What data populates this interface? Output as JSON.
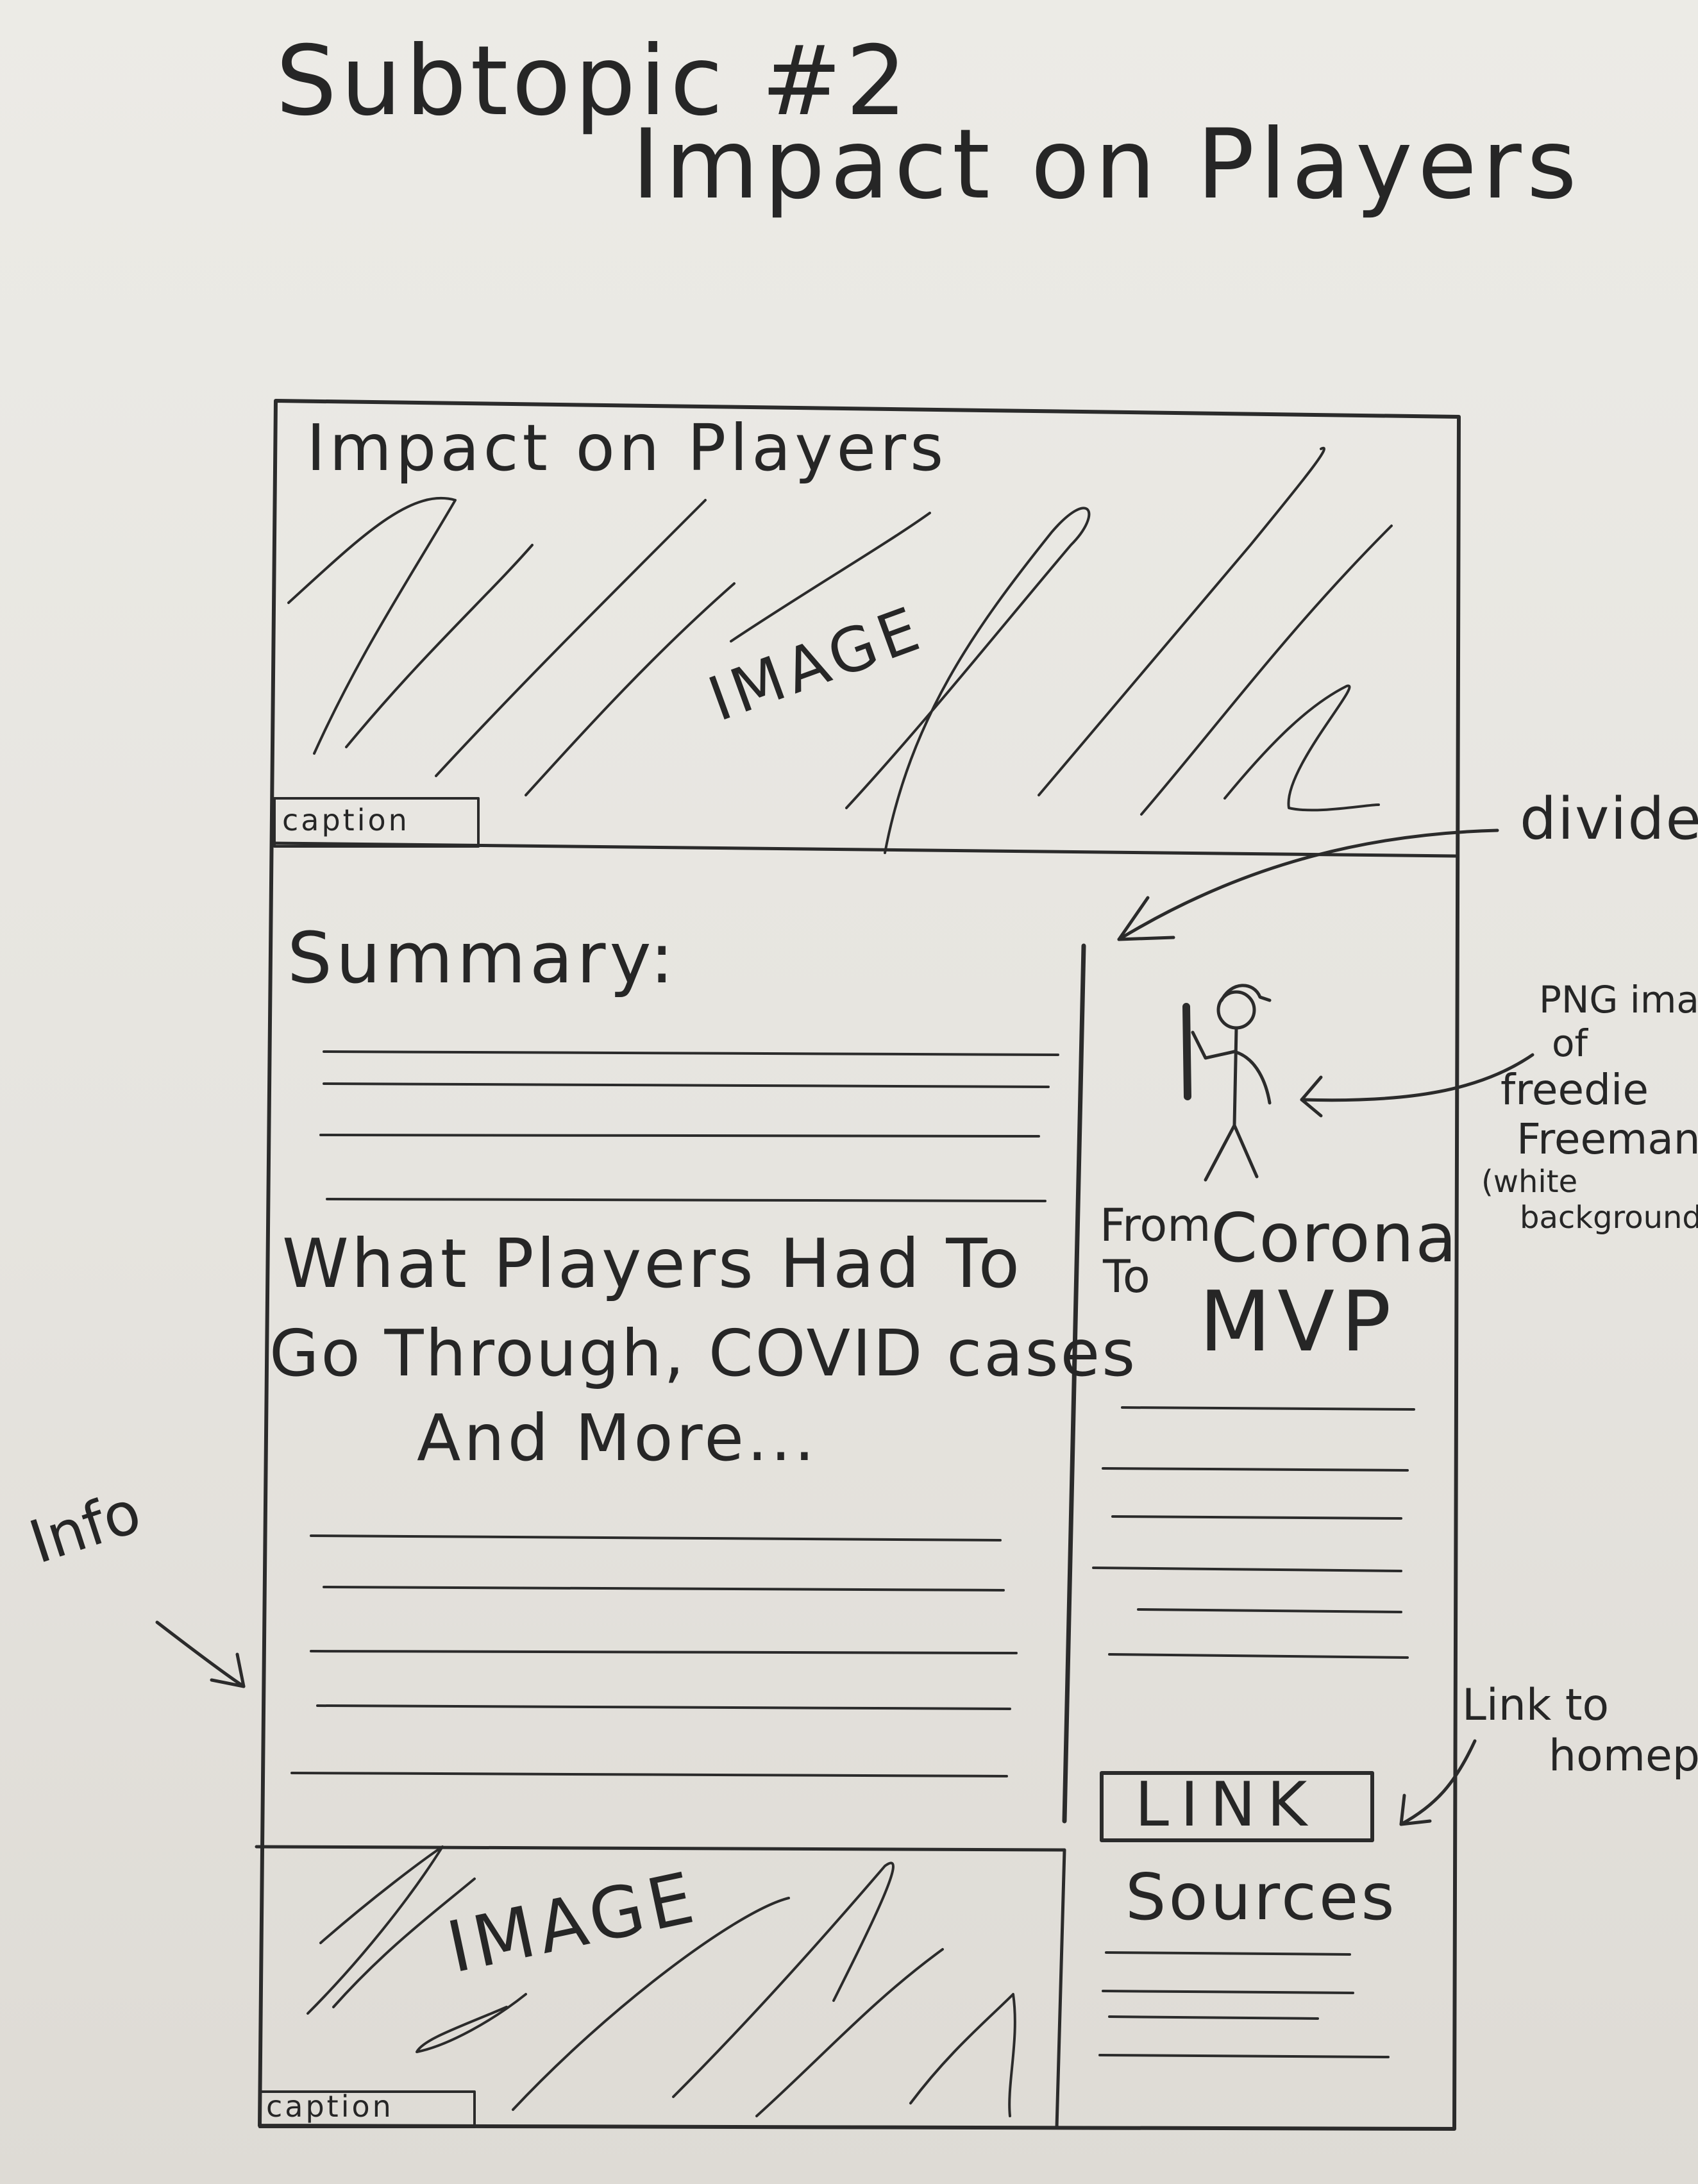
{
  "header": {
    "subtopic": "Subtopic #2",
    "subtitle": "Impact on Players"
  },
  "wireframe": {
    "top_banner": {
      "title": "Impact on Players",
      "image_label": "IMAGE",
      "caption": "caption"
    },
    "summary_label": "Summary:",
    "info_heading_lines": [
      "What Players Had To",
      "Go Through, COVID cases",
      "And More..."
    ],
    "sidebar": {
      "from_to": [
        "From",
        "To"
      ],
      "headline": [
        "Corona",
        "MVP"
      ],
      "link_label": "LINK",
      "sources_label": "Sources"
    },
    "bottom_image": {
      "image_label": "IMAGE",
      "caption": "caption"
    }
  },
  "annotations": {
    "divider": "divider",
    "png_note": [
      "PNG image",
      "of",
      "freedie",
      "Freeman",
      "(white",
      "background)"
    ],
    "info": "Info",
    "link_note": [
      "Link to",
      "homepage"
    ]
  }
}
